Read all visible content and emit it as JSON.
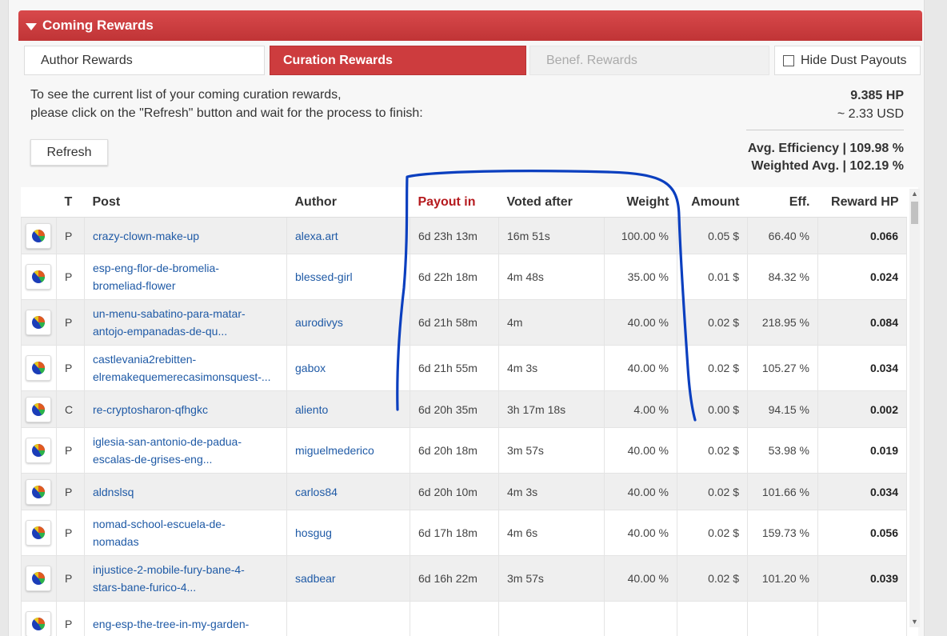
{
  "section": {
    "title": "Coming Rewards"
  },
  "tabs": [
    {
      "label": "Author Rewards"
    },
    {
      "label": "Curation Rewards"
    },
    {
      "label": "Benef. Rewards"
    }
  ],
  "hide_dust": {
    "label": "Hide Dust Payouts",
    "checked": false
  },
  "info": {
    "line1": "To see the current list of your coming curation rewards,",
    "line2": "please click on the \"Refresh\" button and wait for the process to finish:"
  },
  "totals": {
    "hp": "9.385 HP",
    "usd": "~ 2.33 USD",
    "avg_efficiency": "Avg. Efficiency | 109.98 %",
    "weighted_avg": "Weighted Avg. | 102.19 %"
  },
  "refresh_label": "Refresh",
  "table": {
    "headers": [
      "T",
      "Post",
      "Author",
      "Payout in",
      "Voted after",
      "Weight",
      "Amount",
      "Eff.",
      "Reward HP"
    ],
    "rows": [
      {
        "t": "P",
        "post": [
          "crazy-clown-make-up"
        ],
        "author": "alexa.art",
        "payout": "6d 23h 13m",
        "voted": "16m 51s",
        "weight": "100.00 %",
        "amount": "0.05 $",
        "eff": "66.40 %",
        "reward": "0.066"
      },
      {
        "t": "P",
        "post": [
          "esp-eng-flor-de-bromelia-",
          "bromeliad-flower"
        ],
        "author": "blessed-girl",
        "payout": "6d 22h 18m",
        "voted": "4m 48s",
        "weight": "35.00 %",
        "amount": "0.01 $",
        "eff": "84.32 %",
        "reward": "0.024"
      },
      {
        "t": "P",
        "post": [
          "un-menu-sabatino-para-matar-",
          "antojo-empanadas-de-qu..."
        ],
        "author": "aurodivys",
        "payout": "6d 21h 58m",
        "voted": "4m",
        "weight": "40.00 %",
        "amount": "0.02 $",
        "eff": "218.95 %",
        "reward": "0.084"
      },
      {
        "t": "P",
        "post": [
          "castlevania2rebitten-",
          "elremakequemerecasimonsquest-..."
        ],
        "author": "gabox",
        "payout": "6d 21h 55m",
        "voted": "4m 3s",
        "weight": "40.00 %",
        "amount": "0.02 $",
        "eff": "105.27 %",
        "reward": "0.034"
      },
      {
        "t": "C",
        "post": [
          "re-cryptosharon-qfhgkc"
        ],
        "author": "aliento",
        "payout": "6d 20h 35m",
        "voted": "3h 17m 18s",
        "weight": "4.00 %",
        "amount": "0.00 $",
        "eff": "94.15 %",
        "reward": "0.002"
      },
      {
        "t": "P",
        "post": [
          "iglesia-san-antonio-de-padua-",
          "escalas-de-grises-eng..."
        ],
        "author": "miguelmederico",
        "payout": "6d 20h 18m",
        "voted": "3m 57s",
        "weight": "40.00 %",
        "amount": "0.02 $",
        "eff": "53.98 %",
        "reward": "0.019"
      },
      {
        "t": "P",
        "post": [
          "aldnslsq"
        ],
        "author": "carlos84",
        "payout": "6d 20h 10m",
        "voted": "4m 3s",
        "weight": "40.00 %",
        "amount": "0.02 $",
        "eff": "101.66 %",
        "reward": "0.034"
      },
      {
        "t": "P",
        "post": [
          "nomad-school-escuela-de-",
          "nomadas"
        ],
        "author": "hosgug",
        "payout": "6d 17h 18m",
        "voted": "4m 6s",
        "weight": "40.00 %",
        "amount": "0.02 $",
        "eff": "159.73 %",
        "reward": "0.056"
      },
      {
        "t": "P",
        "post": [
          "injustice-2-mobile-fury-bane-4-",
          "stars-bane-furico-4..."
        ],
        "author": "sadbear",
        "payout": "6d 16h 22m",
        "voted": "3m 57s",
        "weight": "40.00 %",
        "amount": "0.02 $",
        "eff": "101.20 %",
        "reward": "0.039"
      },
      {
        "t": "P",
        "post": [
          "eng-esp-the-tree-in-my-garden-",
          ""
        ],
        "author": "",
        "payout": "",
        "voted": "",
        "weight": "",
        "amount": "",
        "eff": "",
        "reward": ""
      }
    ]
  },
  "colors": {
    "header_red": "#c8393b",
    "link_blue": "#1f5aa6",
    "payout_header": "#b51a1e",
    "annotation_blue": "#0b3fbf"
  },
  "icons": {
    "collapse": "caret-down-icon",
    "row_action": "pie-chart-icon"
  }
}
